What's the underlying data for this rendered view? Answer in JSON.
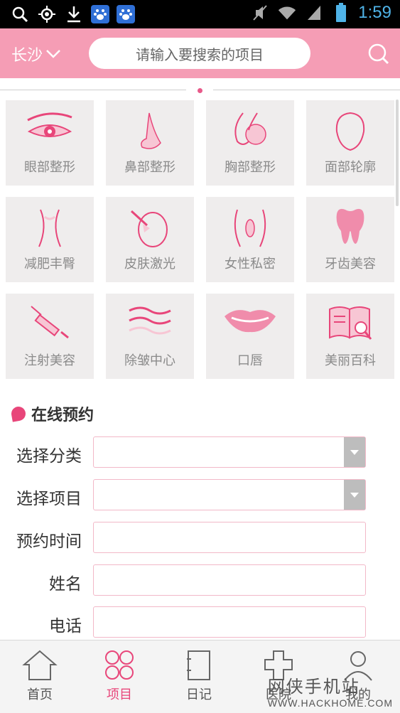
{
  "status_bar": {
    "time": "1:59"
  },
  "header": {
    "city": "长沙",
    "search_placeholder": "请输入要搜索的项目"
  },
  "categories": [
    {
      "label": "眼部整形",
      "icon": "eye-icon"
    },
    {
      "label": "鼻部整形",
      "icon": "nose-icon"
    },
    {
      "label": "胸部整形",
      "icon": "chest-icon"
    },
    {
      "label": "面部轮廓",
      "icon": "face-contour-icon"
    },
    {
      "label": "减肥丰臀",
      "icon": "body-icon"
    },
    {
      "label": "皮肤激光",
      "icon": "laser-icon"
    },
    {
      "label": "女性私密",
      "icon": "female-icon"
    },
    {
      "label": "牙齿美容",
      "icon": "tooth-icon"
    },
    {
      "label": "注射美容",
      "icon": "syringe-icon"
    },
    {
      "label": "除皱中心",
      "icon": "wave-icon"
    },
    {
      "label": "口唇",
      "icon": "lips-icon"
    },
    {
      "label": "美丽百科",
      "icon": "book-icon"
    }
  ],
  "booking": {
    "title": "在线预约",
    "fields": [
      {
        "label": "选择分类",
        "value": "",
        "type": "select"
      },
      {
        "label": "选择项目",
        "value": "",
        "type": "select"
      },
      {
        "label": "预约时间",
        "value": "",
        "type": "text"
      },
      {
        "label": "姓名",
        "value": "",
        "type": "text"
      },
      {
        "label": "电话",
        "value": "",
        "type": "text"
      }
    ]
  },
  "tabs": [
    {
      "label": "首页",
      "icon": "home-icon"
    },
    {
      "label": "项目",
      "icon": "projects-icon",
      "active": true
    },
    {
      "label": "日记",
      "icon": "diary-icon"
    },
    {
      "label": "医院",
      "icon": "hospital-icon"
    },
    {
      "label": "我的",
      "icon": "profile-icon"
    }
  ],
  "watermark": {
    "text": "网侠手机站",
    "url": "WWW.HACKHOME.COM"
  },
  "colors": {
    "brand_pink": "#f59db5",
    "accent": "#e8467a",
    "time_blue": "#4fb3e8"
  }
}
